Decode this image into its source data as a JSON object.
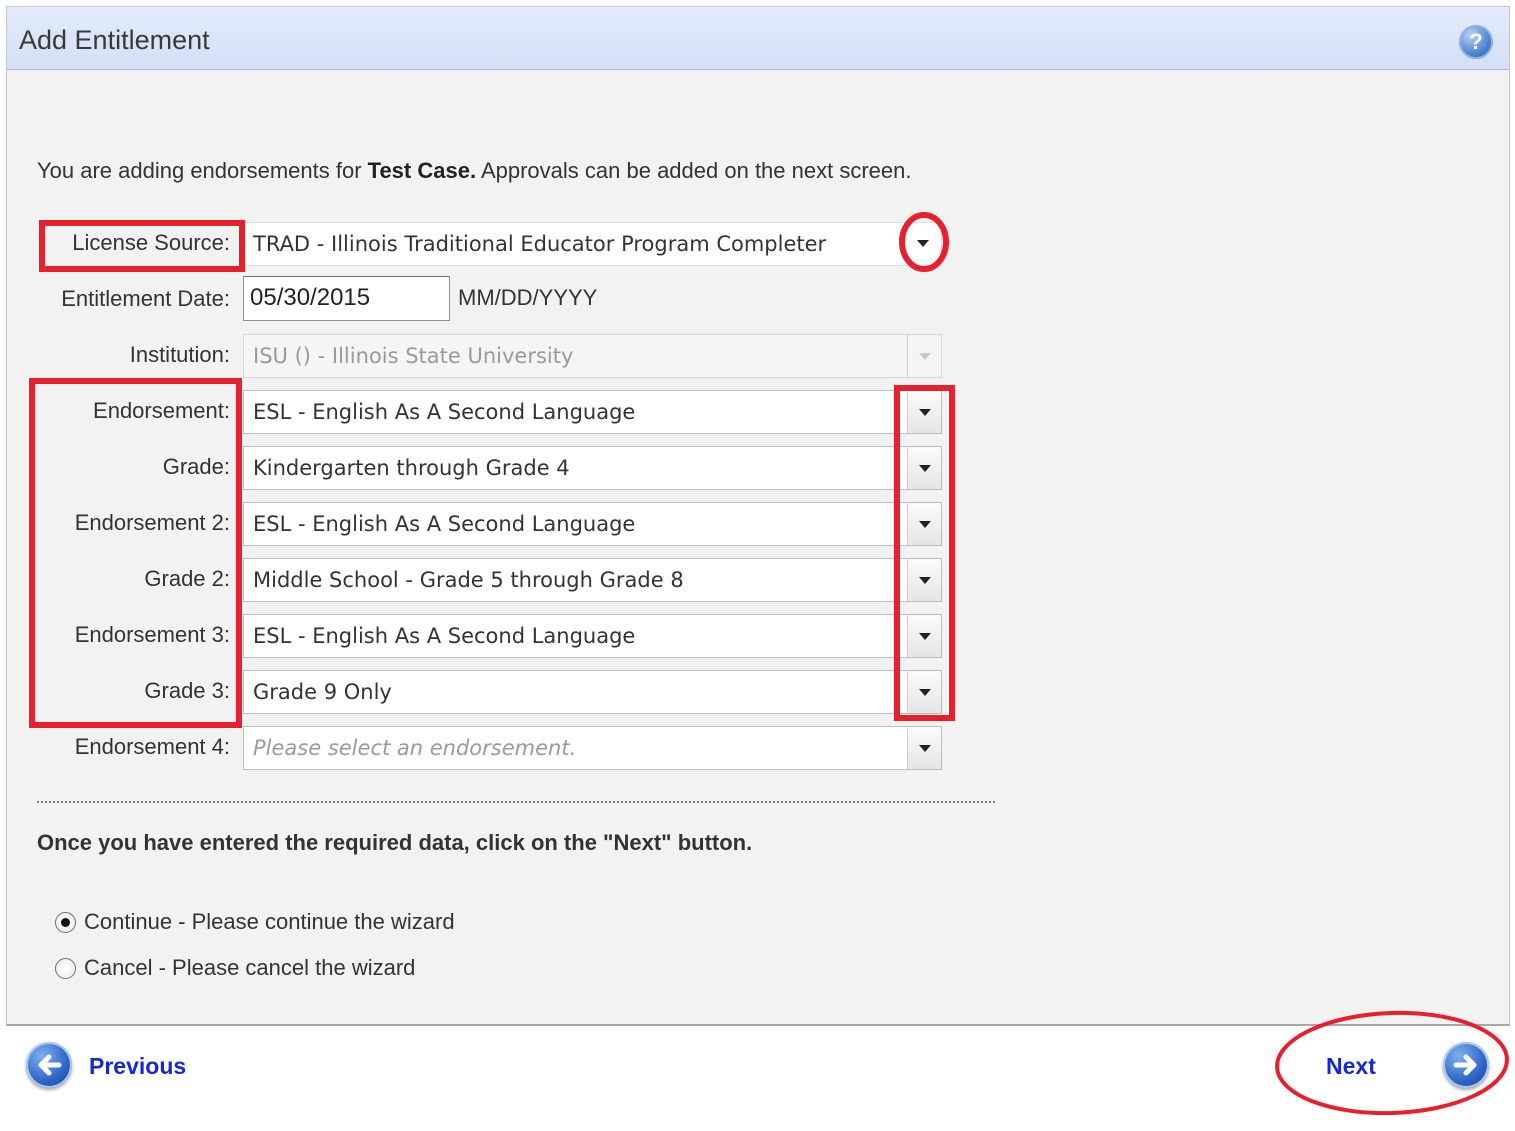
{
  "header": {
    "title": "Add Entitlement",
    "help_icon": "question-mark-icon",
    "help_glyph": "?"
  },
  "intro": {
    "prefix": "You are adding endorsements for ",
    "name": "Test Case.",
    "suffix": " Approvals can be added on the next screen."
  },
  "form": {
    "license_source": {
      "label": "License Source:",
      "value": "TRAD - Illinois Traditional Educator Program Completer"
    },
    "entitlement_date": {
      "label": "Entitlement Date:",
      "value": "05/30/2015",
      "format": "MM/DD/YYYY"
    },
    "institution": {
      "label": "Institution:",
      "value": "ISU () - Illinois State University"
    },
    "endorsement1": {
      "label": "Endorsement:",
      "value": "ESL  - English As A Second Language"
    },
    "grade1": {
      "label": "Grade:",
      "value": "Kindergarten through Grade 4"
    },
    "endorsement2": {
      "label": "Endorsement 2:",
      "value": "ESL  - English As A Second Language"
    },
    "grade2": {
      "label": "Grade 2:",
      "value": "Middle School - Grade 5 through Grade 8"
    },
    "endorsement3": {
      "label": "Endorsement 3:",
      "value": "ESL  - English As A Second Language"
    },
    "grade3": {
      "label": "Grade 3:",
      "value": "Grade 9 Only"
    },
    "endorsement4": {
      "label": "Endorsement 4:",
      "placeholder": "Please select an endorsement."
    }
  },
  "instruction": "Once you have entered the required data, click on the \"Next\" button.",
  "options": [
    {
      "label": "Continue - Please continue the wizard",
      "checked": true
    },
    {
      "label": "Cancel - Please cancel the wizard",
      "checked": false
    }
  ],
  "nav": {
    "previous": "Previous",
    "next": "Next"
  },
  "colors": {
    "annotation": "#e8202e",
    "link": "#1428d8",
    "header_bg": "#d8e4f9"
  }
}
